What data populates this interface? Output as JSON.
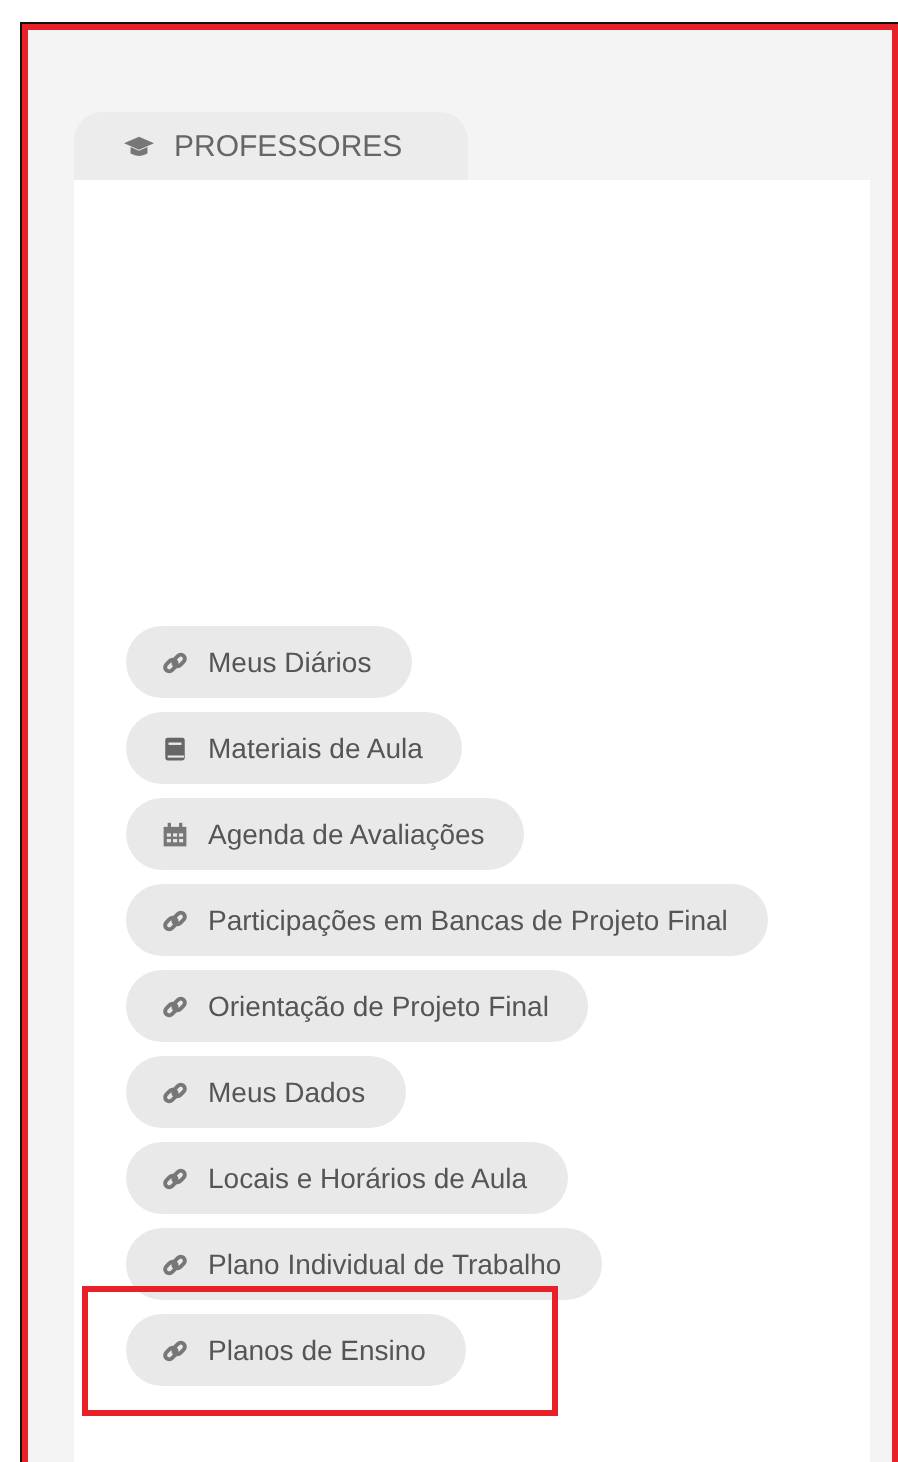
{
  "panel": {
    "tab": {
      "label": "PROFESSORES"
    },
    "items": [
      {
        "label": "Meus Diários",
        "kind": "link",
        "highlighted": false
      },
      {
        "label": "Materiais de Aula",
        "kind": "book",
        "highlighted": false
      },
      {
        "label": "Agenda de Avaliações",
        "kind": "calendar",
        "highlighted": false
      },
      {
        "label": "Participações em Bancas de Projeto Final",
        "kind": "link",
        "highlighted": false
      },
      {
        "label": "Orientação de Projeto Final",
        "kind": "link",
        "highlighted": false
      },
      {
        "label": "Meus Dados",
        "kind": "link",
        "highlighted": false
      },
      {
        "label": "Locais e Horários de Aula",
        "kind": "link",
        "highlighted": false
      },
      {
        "label": "Plano Individual de Trabalho",
        "kind": "link",
        "highlighted": false
      },
      {
        "label": "Planos de Ensino",
        "kind": "link",
        "highlighted": true
      }
    ]
  }
}
